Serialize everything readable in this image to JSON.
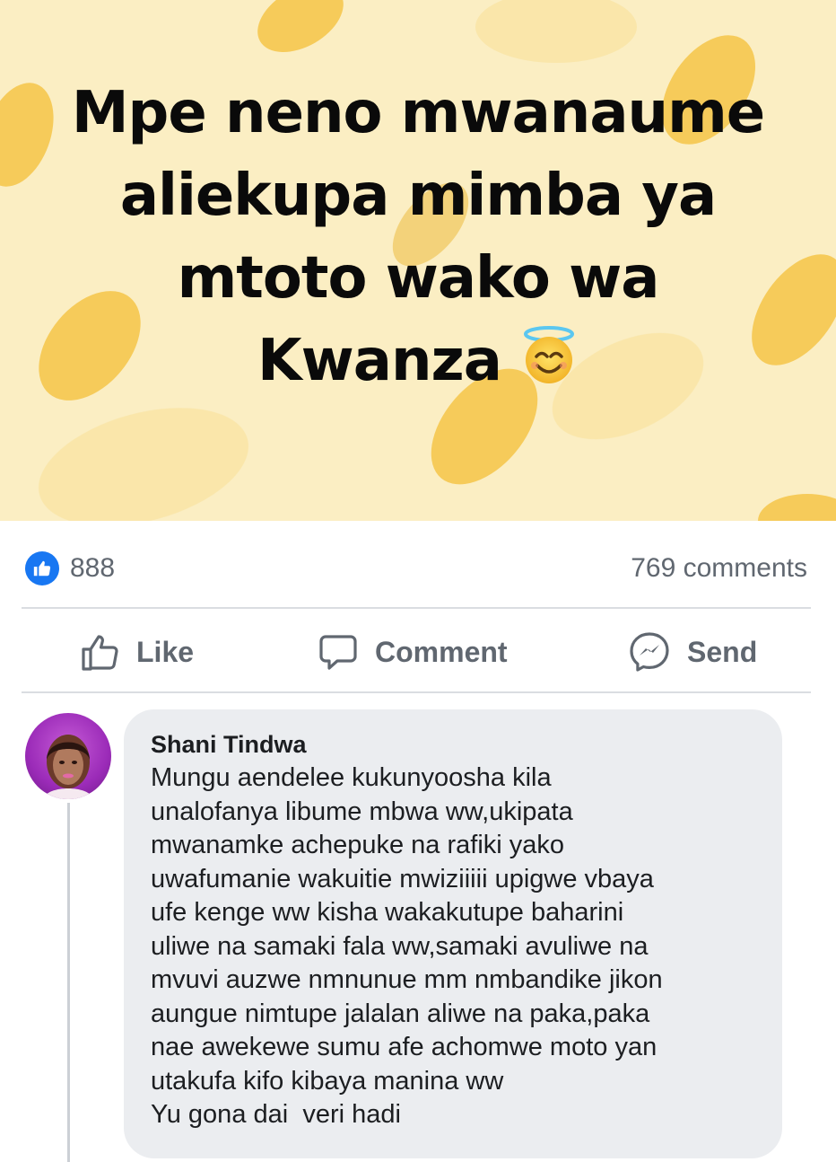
{
  "post": {
    "text_lines": [
      "Mpe neno mwanaume",
      "aliekupa mimba ya",
      "mtoto wako wa",
      "Kwanza"
    ],
    "emoji": "smiling-face-with-halo",
    "background_color": "#fbeec3",
    "blob_color": "#f6cb5a"
  },
  "reactions": {
    "like_count": "888",
    "comments_count": "769 comments"
  },
  "actions": {
    "like_label": "Like",
    "comment_label": "Comment",
    "send_label": "Send"
  },
  "comment": {
    "author": "Shani Tindwa",
    "lines": [
      "Mungu aendelee kukunyoosha kila",
      "unalofanya libume mbwa ww,ukipata",
      "mwanamke achepuke na rafiki yako",
      "uwafumanie wakuitie mwiziiiii upigwe vbaya",
      "ufe kenge ww kisha wakakutupe baharini",
      "uliwe na samaki fala ww,samaki avuliwe na",
      "mvuvi auzwe nmnunue mm nmbandike jikon",
      "aungue nimtupe jalalan aliwe na paka,paka",
      "nae awekewe sumu afe achomwe moto yan",
      "utakufa kifo kibaya manina ww",
      "Yu gona dai  veri hadi"
    ]
  },
  "colors": {
    "facebook_blue": "#1877f2",
    "muted_text": "#606770",
    "bubble_bg": "#ebedf0"
  }
}
